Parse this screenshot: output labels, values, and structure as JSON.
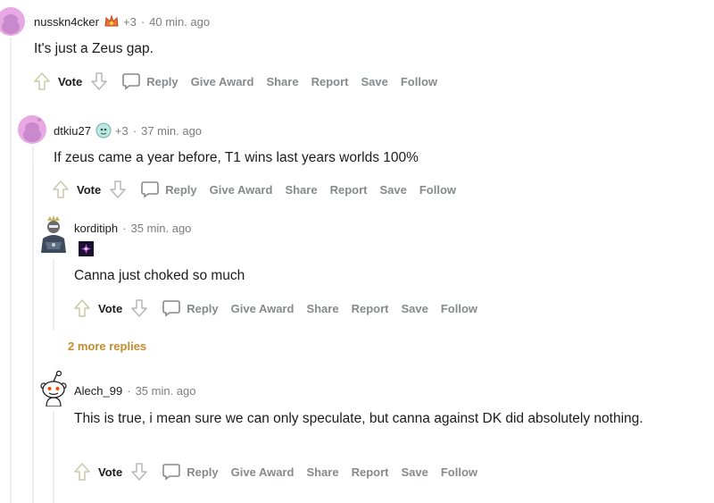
{
  "actions": {
    "vote": "Vote",
    "reply": "Reply",
    "give_award": "Give Award",
    "share": "Share",
    "report": "Report",
    "save": "Save",
    "follow": "Follow"
  },
  "comments": [
    {
      "username": "nusskn4cker",
      "flair_icon": "crown-flair-icon",
      "flair_extra": "+3",
      "time": "40 min. ago",
      "text": "It's just a Zeus gap."
    },
    {
      "username": "dtkiu27",
      "flair_icon": "character-flair-icon",
      "flair_extra": "+3",
      "time": "37 min. ago",
      "text": "If zeus came a year before, T1 wins last years worlds 100%"
    },
    {
      "username": "korditiph",
      "flair_icon": "purple-emblem-icon",
      "time": "35 min. ago",
      "text": "Canna just choked so much"
    },
    {
      "username": "Alech_99",
      "time": "35 min. ago",
      "text": "This is true, i mean sure we can only speculate, but canna against DK did absolutely nothing."
    }
  ],
  "more_replies": "2 more replies",
  "colors": {
    "username": "#1c1c1c",
    "meta": "#7c7c7c",
    "action": "#878a8c",
    "more_replies": "#c58b2a",
    "avatar_pink": "#e7a8e3"
  }
}
